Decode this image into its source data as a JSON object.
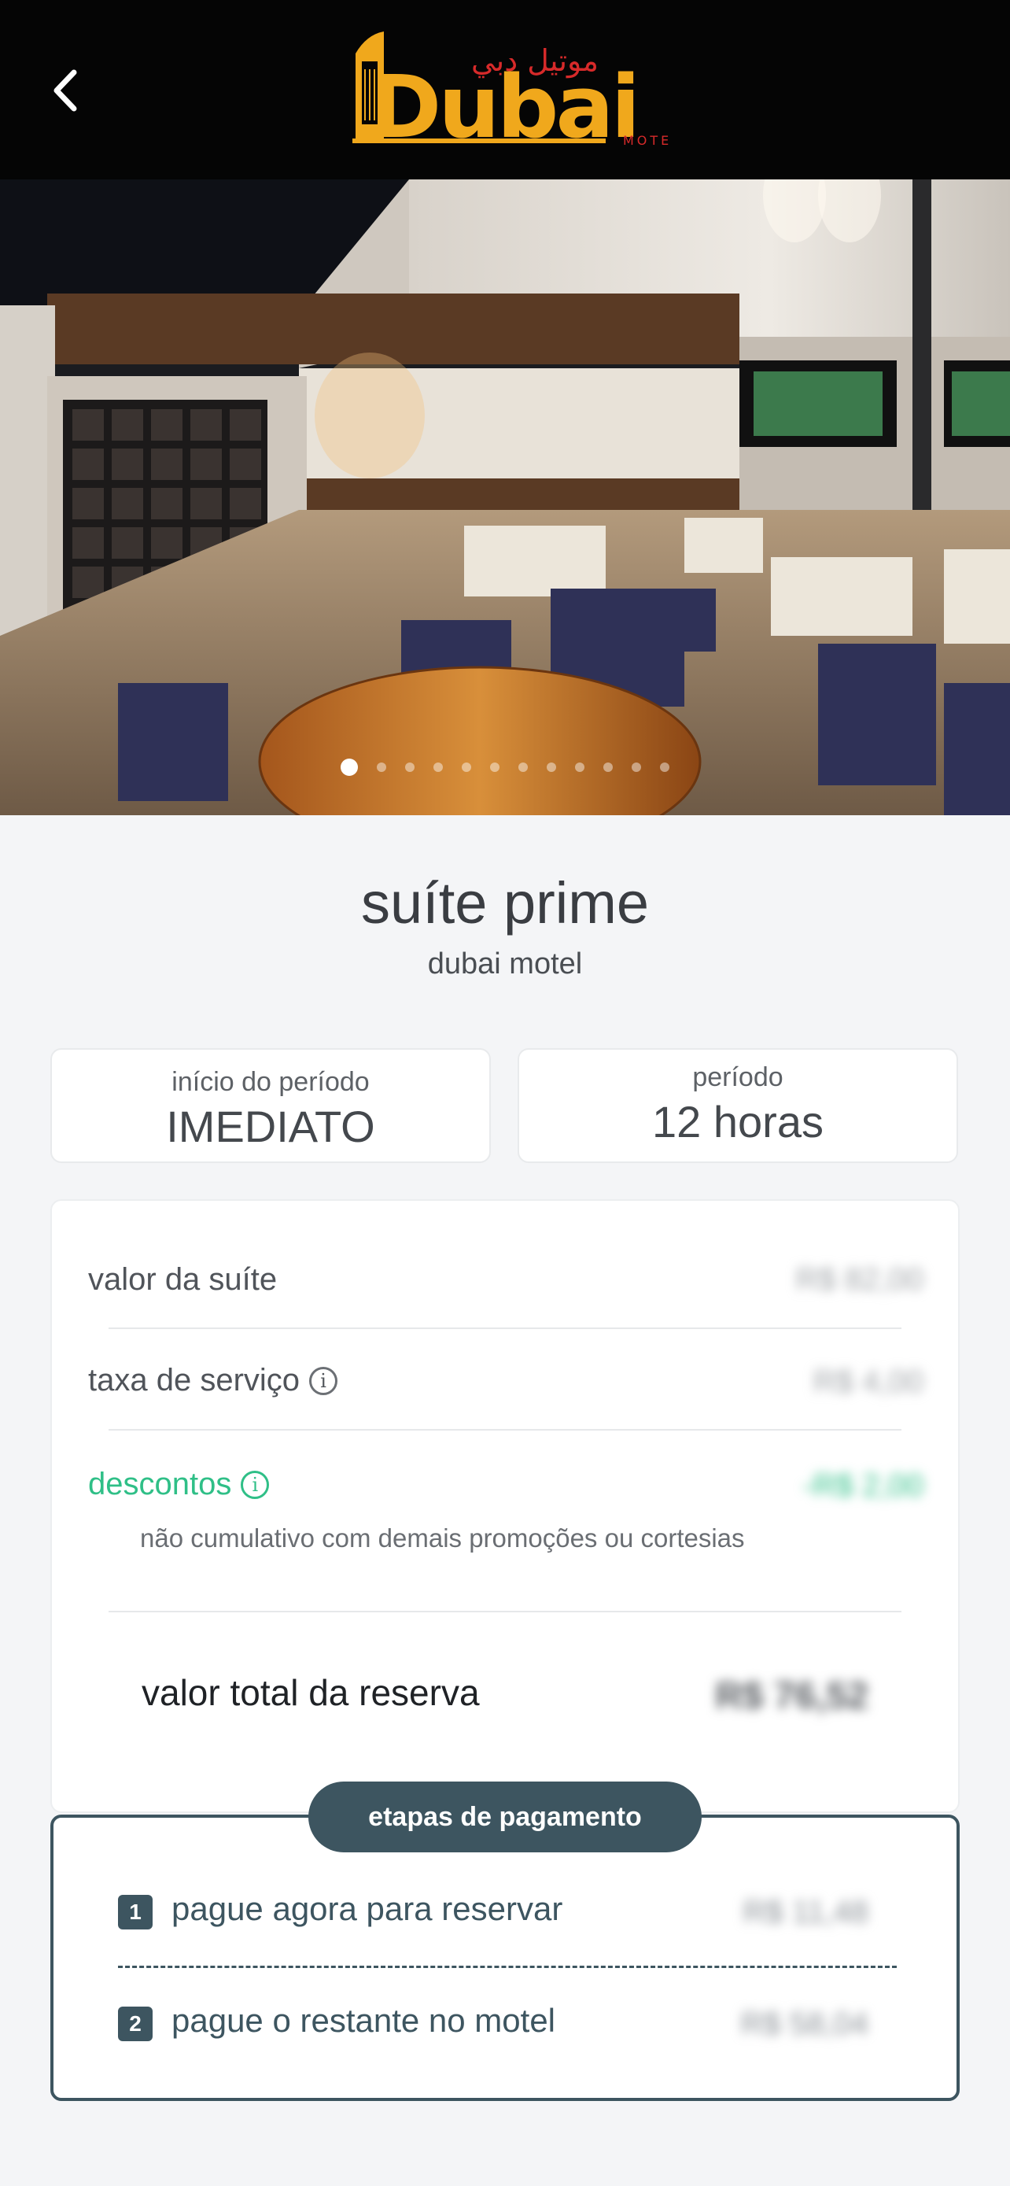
{
  "header": {
    "back_icon": "chevron-left-icon",
    "logo": {
      "text": "Dubai",
      "arabic": "موتيل دبي",
      "sub": "MOTEL",
      "primary_color": "#f0a81c",
      "accent_color": "#d72a2a"
    }
  },
  "hero": {
    "slide_count": 12,
    "active_slide": 1
  },
  "suite": {
    "title": "suíte prime",
    "subtitle": "dubai motel"
  },
  "period": {
    "start_label": "início do período",
    "start_value": "IMEDIATO",
    "duration_label": "período",
    "duration_value": "12 horas"
  },
  "pricing": {
    "suite_label": "valor da suíte",
    "suite_value": "R$ 82,00",
    "service_label": "taxa de serviço",
    "service_value": "R$ 4,00",
    "discount_label": "descontos",
    "discount_value": "-R$ 2,00",
    "discount_note": "não cumulativo com demais promoções ou cortesias",
    "total_label": "valor total da reserva",
    "total_value": "R$ 76,52"
  },
  "payment_steps": {
    "title": "etapas de pagamento",
    "steps": [
      {
        "number": "1",
        "label": "pague agora para reservar",
        "value": "R$ 11,48"
      },
      {
        "number": "2",
        "label": "pague o restante no motel",
        "value": "R$ 58,04"
      }
    ]
  },
  "colors": {
    "header_bg": "#050505",
    "accent_dark": "#3d5560",
    "discount_green": "#2fbf87"
  }
}
